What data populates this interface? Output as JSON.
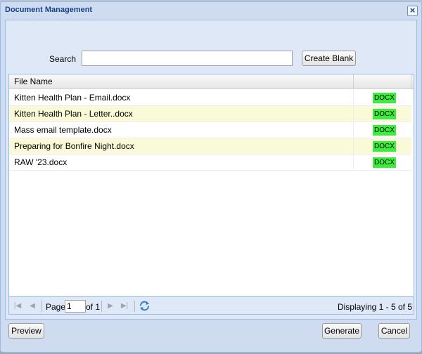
{
  "window": {
    "title": "Document Management"
  },
  "search": {
    "label": "Search",
    "value": "",
    "placeholder": ""
  },
  "toolbar": {
    "create_blank_label": "Create Blank"
  },
  "grid": {
    "columns": [
      "File Name",
      ""
    ],
    "rows": [
      {
        "name": "Kitten Health Plan - Email.docx",
        "type": "DOCX"
      },
      {
        "name": "Kitten Health Plan - Letter..docx",
        "type": "DOCX"
      },
      {
        "name": "Mass email template.docx",
        "type": "DOCX"
      },
      {
        "name": "Preparing for Bonfire Night.docx",
        "type": "DOCX"
      },
      {
        "name": "RAW '23.docx",
        "type": "DOCX"
      }
    ]
  },
  "pager": {
    "page_label": "Page",
    "page_value": "1",
    "of_label": "of 1",
    "display_text": "Displaying 1 - 5 of 5"
  },
  "footer": {
    "preview_label": "Preview",
    "generate_label": "Generate",
    "cancel_label": "Cancel"
  },
  "colors": {
    "title": "#15428b",
    "panel": "#dfe8f6",
    "border": "#99bbe8",
    "badge": "#3cee3c",
    "alt_row": "#fafad8"
  },
  "icons": {
    "close": "close-icon",
    "first": "first-page-icon",
    "prev": "prev-page-icon",
    "next": "next-page-icon",
    "last": "last-page-icon",
    "refresh": "refresh-icon"
  }
}
